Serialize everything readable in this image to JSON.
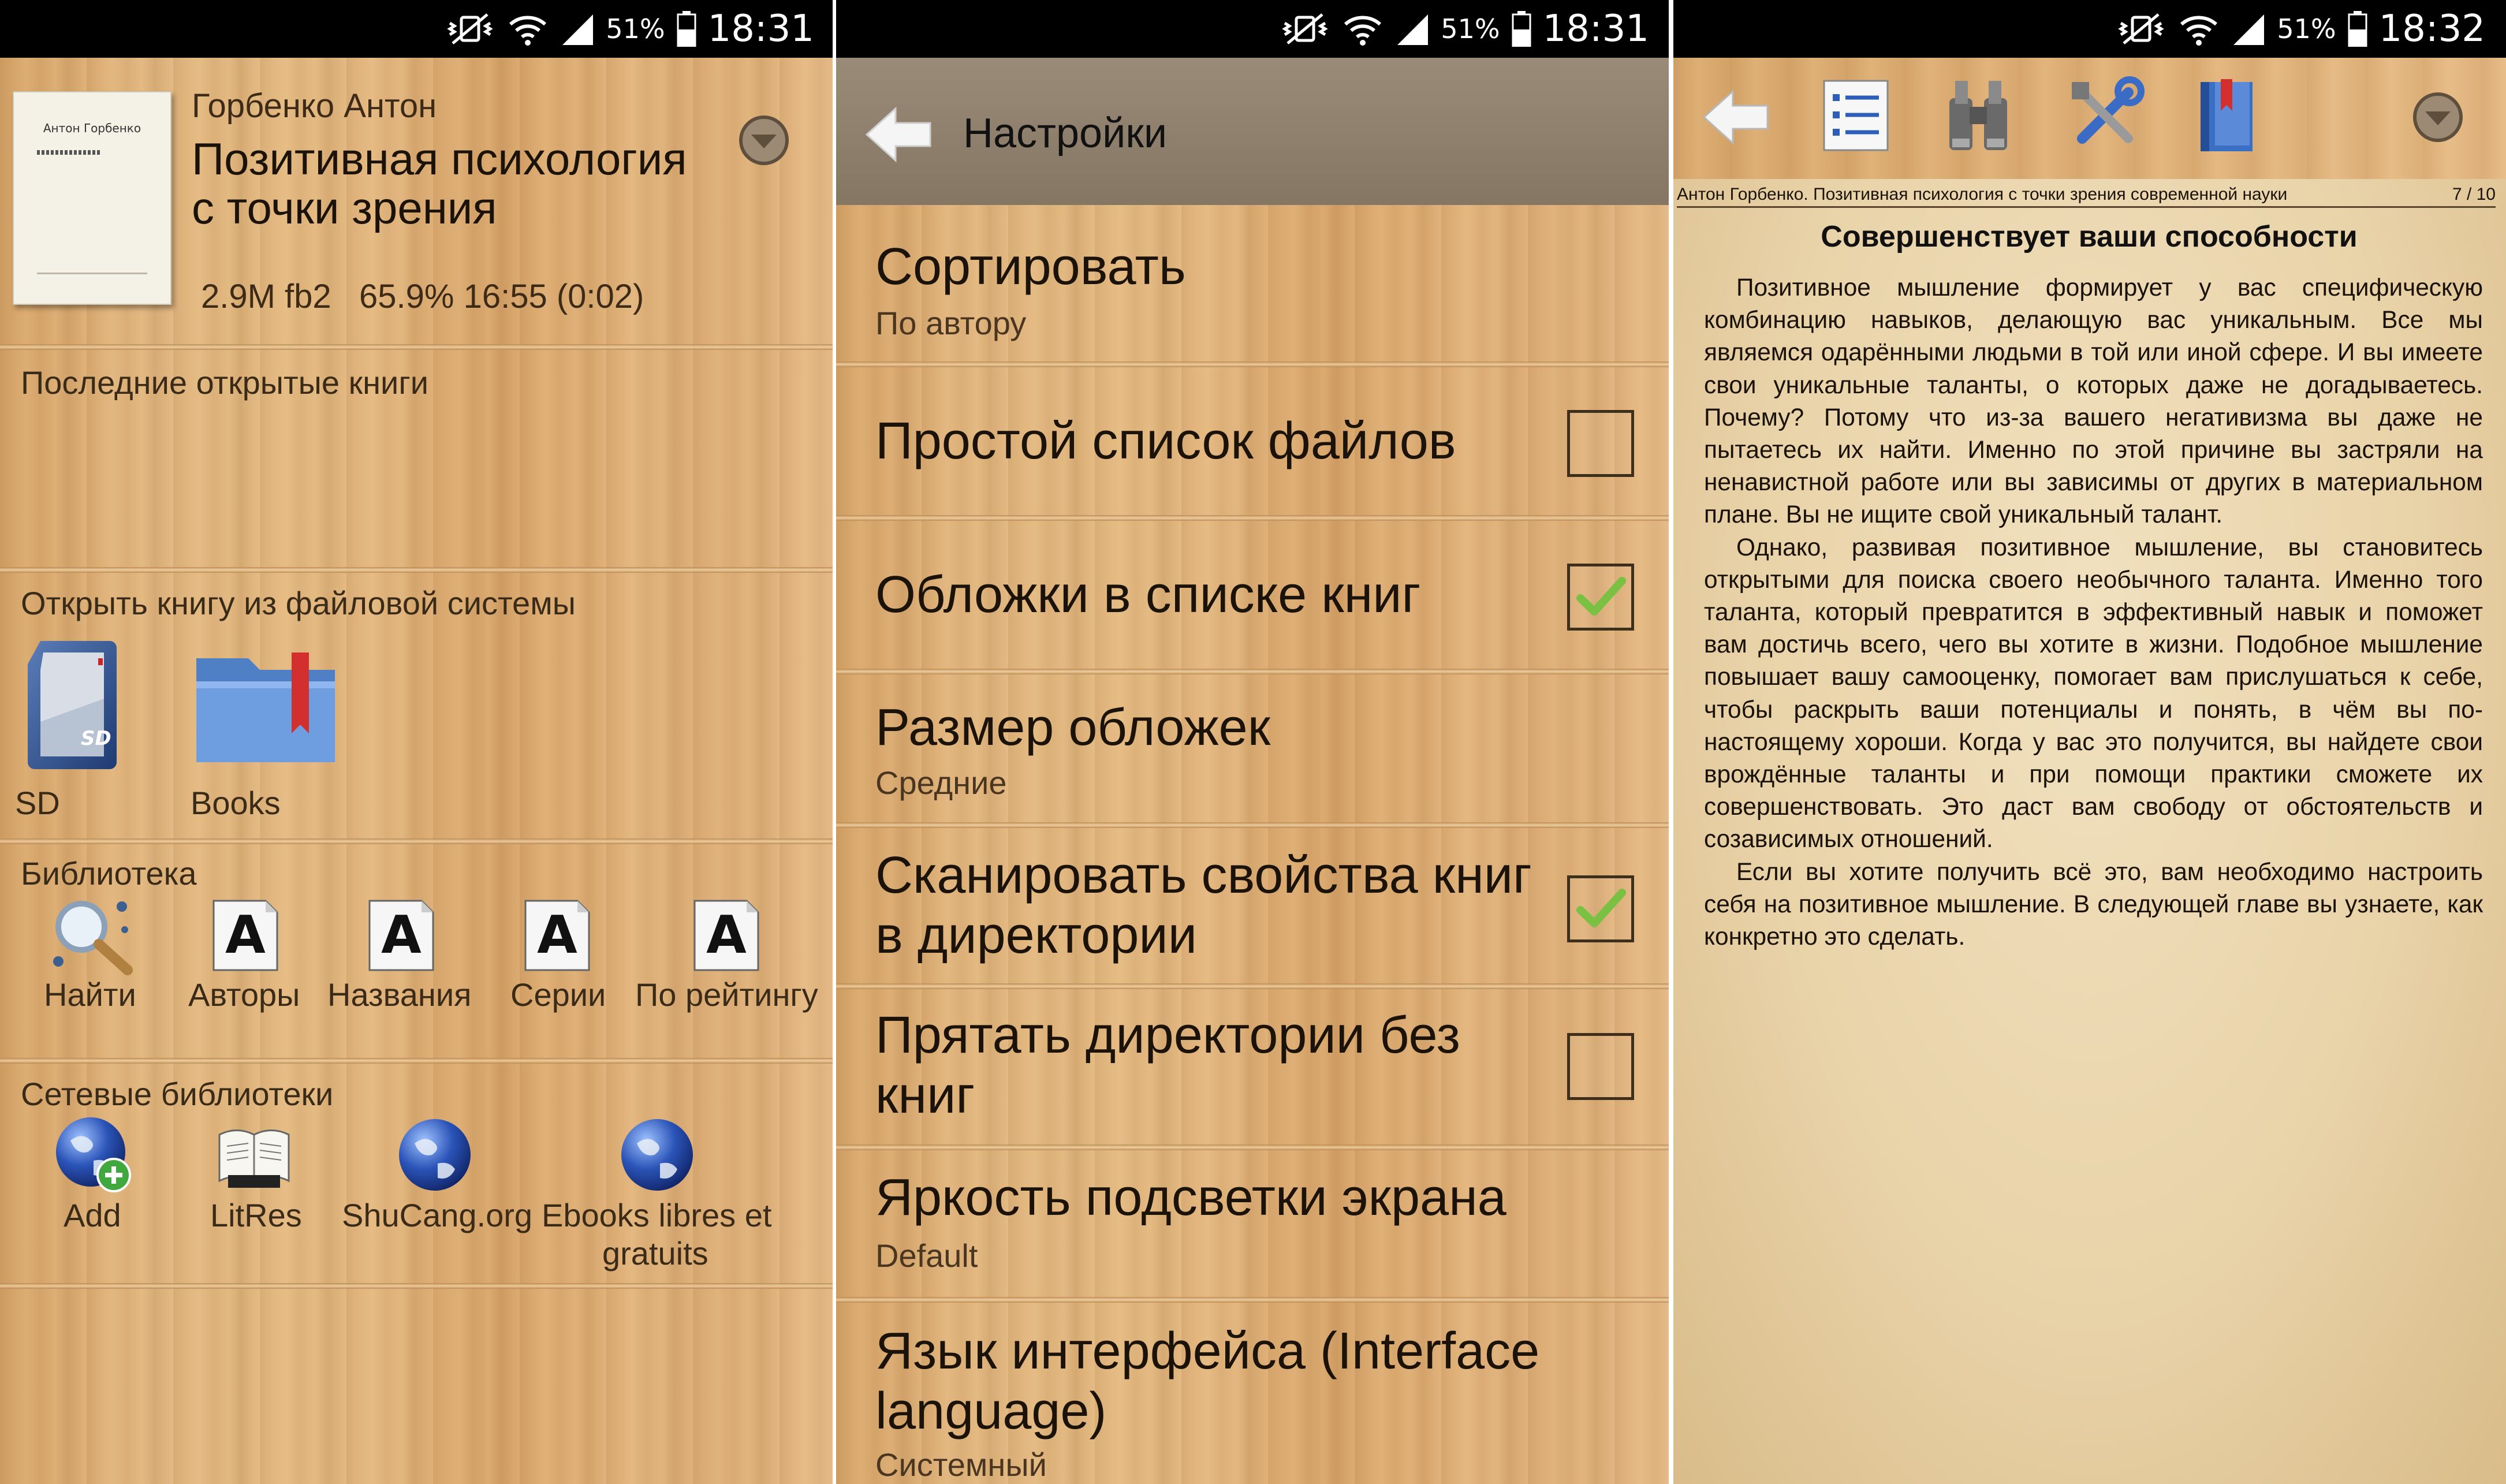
{
  "status": {
    "panel1": {
      "battery": "51%",
      "time": "18:31"
    },
    "panel2": {
      "battery": "51%",
      "time": "18:31"
    },
    "panel3": {
      "battery": "51%",
      "time": "18:32"
    }
  },
  "home": {
    "current_book": {
      "cover_author": "Антон Горбенко",
      "author": "Горбенко Антон",
      "title_line1": "Позитивная психология",
      "title_line2": "с точки зрения",
      "info": "2.9M fb2   65.9% 16:55 (0:02)"
    },
    "recent_header": "Последние открытые книги",
    "filesystem_header": "Открыть книгу из файловой системы",
    "filesystem_items": [
      {
        "label": "SD",
        "icon": "sd-card-icon"
      },
      {
        "label": "Books",
        "icon": "books-folder-icon"
      }
    ],
    "library_header": "Библиотека",
    "library_items": [
      {
        "label": "Найти",
        "icon": "search-icon"
      },
      {
        "label": "Авторы",
        "icon": "authors-icon"
      },
      {
        "label": "Названия",
        "icon": "titles-icon"
      },
      {
        "label": "Серии",
        "icon": "series-icon"
      },
      {
        "label": "По рейтингу",
        "icon": "rating-icon"
      }
    ],
    "network_header": "Сетевые библиотеки",
    "network_items": [
      {
        "label": "Add",
        "icon": "globe-add-icon"
      },
      {
        "label": "LitRes",
        "icon": "litres-book-icon"
      },
      {
        "label": "ShuCang.org",
        "icon": "globe-icon"
      },
      {
        "label_line1": "Ebooks libres et",
        "label_line2": "gratuits",
        "icon": "globe-icon"
      }
    ]
  },
  "settings": {
    "title": "Настройки",
    "items": [
      {
        "title": "Сортировать",
        "subtitle": "По автору"
      },
      {
        "title": "Простой список файлов",
        "checked": false
      },
      {
        "title": "Обложки в списке книг",
        "checked": true
      },
      {
        "title": "Размер обложек",
        "subtitle": "Средние"
      },
      {
        "title_line1": "Сканировать свойства книг",
        "title_line2": "в директории",
        "checked": true
      },
      {
        "title_line1": "Прятать директории без",
        "title_line2": "книг",
        "checked": false
      },
      {
        "title": "Яркость подсветки экрана",
        "subtitle": "Default"
      },
      {
        "title_line1": "Язык интерфейса (Interface",
        "title_line2": "language)",
        "subtitle": "Системный"
      }
    ]
  },
  "reader": {
    "header_left": "Антон Горбенко. Позитивная психология с точки зрения современной науки",
    "page": "7 / 10",
    "chapter_title": "Совершенствует ваши способности",
    "paragraphs": [
      "Позитивное мышление формирует у вас специфическую комбинацию навыков, делающую вас уникальным. Все мы являемся одарёнными людьми в той или иной сфере. И вы имеете свои уникальные таланты, о которых даже не догадываетесь. Почему? Потому что из-за вашего негативизма вы даже не пытаетесь их найти. Именно по этой причине вы застряли на ненавистной работе или вы зависимы от других в материальном плане. Вы не ищите свой уникальный талант.",
      "Однако, развивая позитивное мышление, вы становитесь открытыми для поиска своего необычного таланта. Именно того таланта, который превратится в эффективный навык и поможет вам достичь всего, чего вы хотите в жизни. Подобное мышление повышает вашу самооценку, помогает вам прислушаться к себе, чтобы раскрыть ваши потенциалы и понять, в чём вы по-настоящему хороши. Когда у вас это получится, вы найдете свои врождённые таланты и при помощи практики сможете их совершенствовать. Это даст вам свободу от обстоятельств и созависимых отношений.",
      "Если вы хотите получить всё это, вам необходимо настроить себя на позитивное мышление. В следующей главе вы узнаете, как конкретно это сделать."
    ]
  },
  "colors": {
    "wood": "#e0b27a",
    "settings_header": "#8c7c6a",
    "reader_toolbar": "#d9a86c",
    "paper": "#ecd9b2",
    "check_green": "#7ac143"
  }
}
